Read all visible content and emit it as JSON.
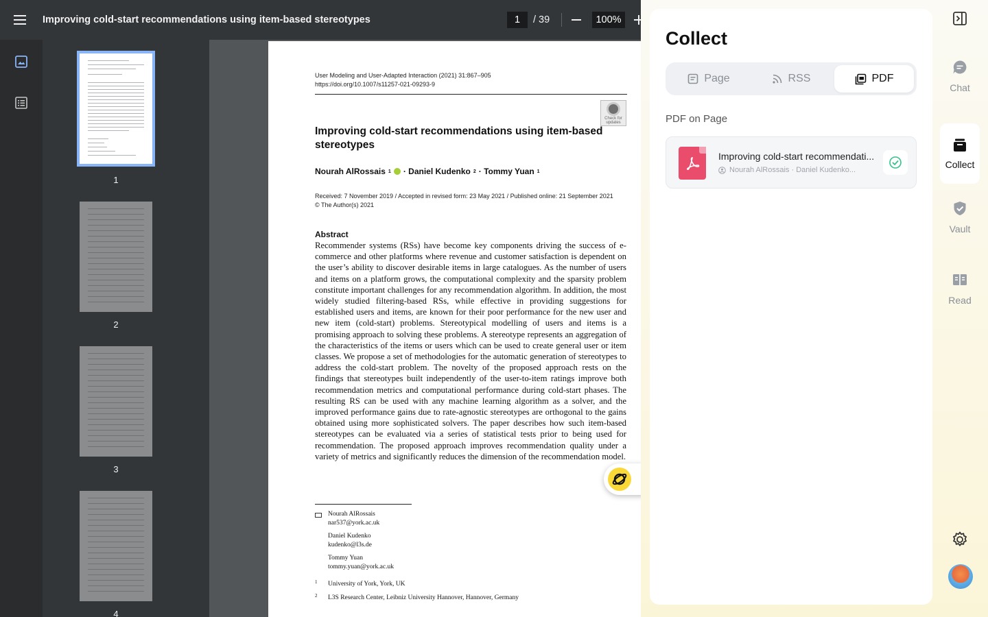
{
  "viewer": {
    "title": "Improving cold-start recommendations using item-based stereotypes",
    "page_current": "1",
    "page_total": "/ 39",
    "zoom": "100%"
  },
  "thumbnails": [
    {
      "label": "1"
    },
    {
      "label": "2"
    },
    {
      "label": "3"
    },
    {
      "label": "4"
    }
  ],
  "document": {
    "journal_line1": "User Modeling and User-Adapted Interaction (2021) 31:867–905",
    "journal_line2": "https://doi.org/10.1007/s11257-021-09293-9",
    "check_updates": "Check for updates",
    "title": "Improving cold-start recommendations using item-based stereotypes",
    "author1": "Nourah AlRossais",
    "author1_sup": "1",
    "author2": "· Daniel Kudenko",
    "author2_sup": "2",
    "author3": "· Tommy Yuan",
    "author3_sup": "1",
    "received_line1": "Received: 7 November 2019 / Accepted in revised form: 23 May 2021 / Published online: 21 September 2021",
    "received_line2": "© The Author(s) 2021",
    "abstract_heading": "Abstract",
    "abstract_text": "Recommender systems (RSs) have become key components driving the success of e-commerce and other platforms where revenue and customer satisfaction is dependent on the user’s ability to discover desirable items in large catalogues. As the number of users and items on a platform grows, the computational complexity and the sparsity problem constitute important challenges for any recommendation algorithm. In addition, the most widely studied filtering-based RSs, while effective in providing suggestions for established users and items, are known for their poor performance for the new user and new item (cold-start) problems. Stereotypical modelling of users and items is a promising approach to solving these problems. A stereotype represents an aggregation of the characteristics of the items or users which can be used to create general user or item classes. We propose a set of methodologies for the automatic generation of stereotypes to address the cold-start problem. The novelty of the proposed approach rests on the findings that stereotypes built independently of the user-to-item ratings improve both recommendation metrics and computational performance during cold-start phases. The resulting RS can be used with any machine learning algorithm as a solver, and the improved performance gains due to rate-agnostic stereotypes are orthogonal to the gains obtained using more sophisticated solvers. The paper describes how such item-based stereotypes can be evaluated via a series of statistical tests prior to being used for recommendation. The proposed approach improves recommendation quality under a variety of metrics and significantly reduces the dimension of the recommendation model.",
    "fn_name1": "Nourah AlRossais",
    "fn_email1": "nar537@york.ac.uk",
    "fn_name2": "Daniel Kudenko",
    "fn_email2": "kudenko@l3s.de",
    "fn_name3": "Tommy Yuan",
    "fn_email3": "tommy.yuan@york.ac.uk",
    "aff1_mark": "1",
    "aff1": "University of York, York, UK",
    "aff2_mark": "2",
    "aff2": "L3S Research Center, Leibniz University Hannover, Hannover, Germany"
  },
  "panel": {
    "title": "Collect",
    "tabs": [
      {
        "label": "Page",
        "icon": "page-icon"
      },
      {
        "label": "RSS",
        "icon": "rss-icon"
      },
      {
        "label": "PDF",
        "icon": "pdf-tab-icon",
        "active": true
      }
    ],
    "section_label": "PDF on Page",
    "pdf_item": {
      "name": "Improving cold-start recommendati...",
      "authors": "Nourah AlRossais · Daniel Kudenko..."
    }
  },
  "rail": {
    "chat": "Chat",
    "collect": "Collect",
    "vault": "Vault",
    "read": "Read"
  },
  "colors": {
    "toolbar": "#323639",
    "pdf_icon": "#ea4c6c",
    "check": "#34c28a",
    "accent_yellow": "#f9d838"
  }
}
